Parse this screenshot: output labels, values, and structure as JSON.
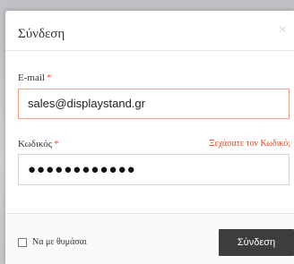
{
  "modal": {
    "title": "Σύνδεση",
    "close_glyph": "×"
  },
  "form": {
    "email": {
      "label": "E-mail",
      "required_mark": "*",
      "value": "sales@displaystand.gr"
    },
    "password": {
      "label": "Κωδικός",
      "required_mark": "*",
      "masked_value": "●●●●●●●●●●●●",
      "forgot_link": "Ξεχάσατε τον Κωδικό;"
    }
  },
  "footer": {
    "remember_label": "Να με θυμάσαι",
    "remember_checked": false,
    "submit_label": "Σύνδεση"
  },
  "colors": {
    "required": "#e0543b",
    "forgot_link": "#d9472b",
    "email_focus_border": "#f0a487",
    "submit_bg": "#3d3d3d"
  },
  "icons": {
    "close": "close-icon",
    "checkbox": "checkbox-icon"
  }
}
